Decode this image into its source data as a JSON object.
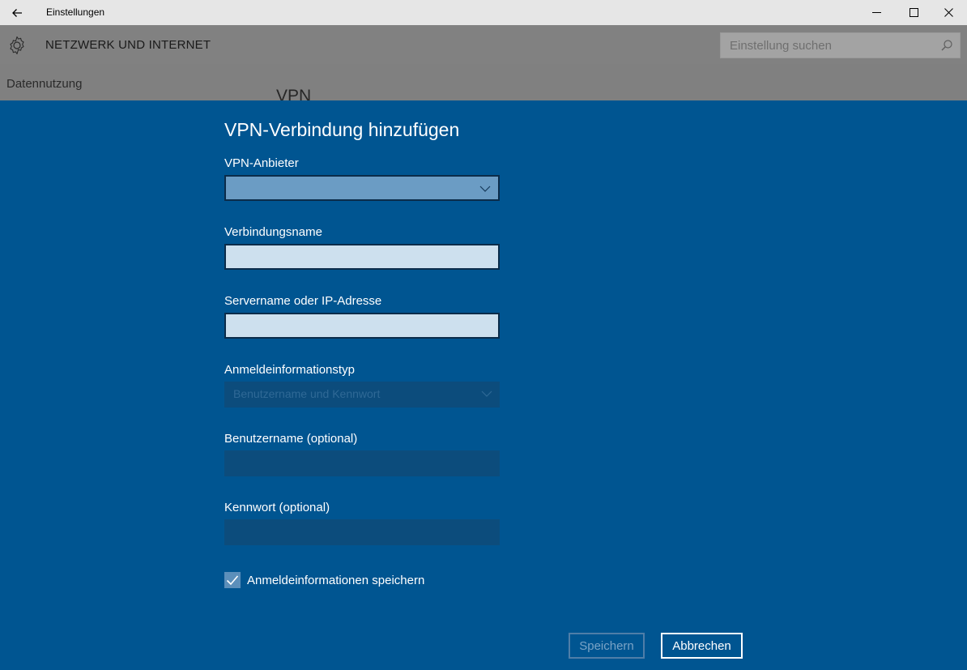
{
  "window": {
    "title": "Einstellungen"
  },
  "header": {
    "section_title": "NETZWERK UND INTERNET",
    "search_placeholder": "Einstellung suchen"
  },
  "sidebar": {
    "items": [
      {
        "label": "Datennutzung"
      }
    ]
  },
  "page": {
    "title": "VPN"
  },
  "dialog": {
    "title": "VPN-Verbindung hinzufügen",
    "fields": {
      "provider": {
        "label": "VPN-Anbieter",
        "value": ""
      },
      "connection_name": {
        "label": "Verbindungsname",
        "value": ""
      },
      "server": {
        "label": "Servername oder IP-Adresse",
        "value": ""
      },
      "signin_type": {
        "label": "Anmeldeinformationstyp",
        "value": "Benutzername und Kennwort"
      },
      "username": {
        "label": "Benutzername (optional)",
        "value": ""
      },
      "password": {
        "label": "Kennwort (optional)",
        "value": ""
      }
    },
    "remember": {
      "label": "Anmeldeinformationen speichern",
      "checked": true
    },
    "buttons": {
      "save": "Speichern",
      "cancel": "Abbrechen"
    }
  },
  "colors": {
    "dialog_bg": "#005591",
    "overlay_gray": "#808080",
    "titlebar_bg": "#e6e6e6"
  },
  "icons": {
    "back": "arrow-left-icon",
    "minimize": "minimize-icon",
    "maximize": "maximize-icon",
    "close": "close-icon",
    "settings": "gear-icon",
    "search": "search-icon",
    "dropdown": "chevron-down-icon",
    "checkbox": "checkmark-icon"
  }
}
